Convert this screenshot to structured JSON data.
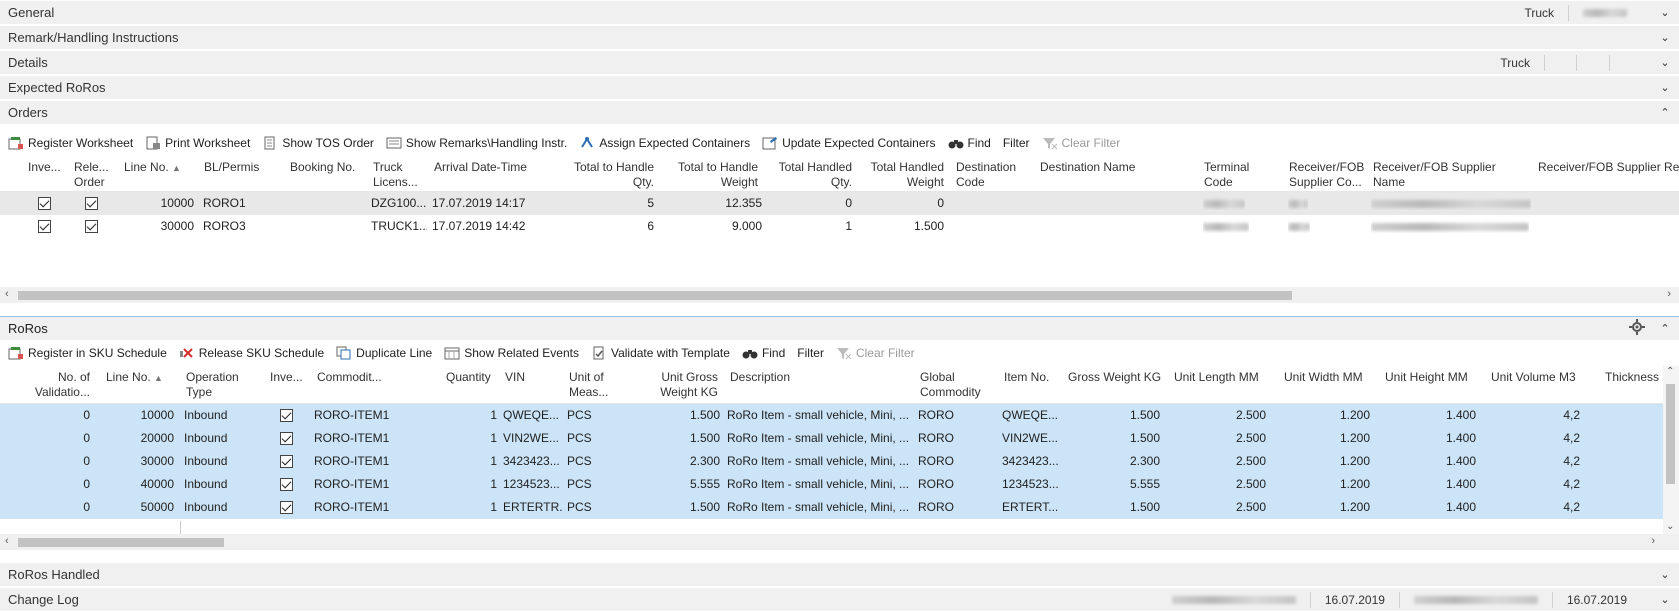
{
  "fasttabs": {
    "general": {
      "title": "General",
      "summary": "Truck"
    },
    "remark": {
      "title": "Remark/Handling Instructions"
    },
    "details": {
      "title": "Details",
      "summary": "Truck"
    },
    "expected": {
      "title": "Expected RoRos"
    },
    "orders": {
      "title": "Orders"
    },
    "roros_handled": {
      "title": "RoRos Handled"
    },
    "change_log": {
      "title": "Change Log",
      "date1": "16.07.2019",
      "date2": "16.07.2019"
    }
  },
  "orders_toolbar": {
    "register_worksheet": "Register Worksheet",
    "print_worksheet": "Print Worksheet",
    "show_tos_order": "Show TOS Order",
    "show_remarks": "Show Remarks\\Handling Instr.",
    "assign_expected": "Assign Expected Containers",
    "update_expected": "Update Expected Containers",
    "find": "Find",
    "filter": "Filter",
    "clear_filter": "Clear Filter"
  },
  "orders_grid": {
    "headers": {
      "inve": "Inve...",
      "rele1": "Rele...",
      "rele2": "Order",
      "line_no": "Line No.",
      "bl": "BL/Permis",
      "booking": "Booking No.",
      "truck1": "Truck",
      "truck2": "Licens...",
      "arrival": "Arrival Date-Time",
      "tth_qty1": "Total to Handle",
      "tth_qty2": "Qty.",
      "tth_w1": "Total to Handle",
      "tth_w2": "Weight",
      "th_qty1": "Total Handled",
      "th_qty2": "Qty.",
      "th_w1": "Total Handled",
      "th_w2": "Weight",
      "dest1": "Destination",
      "dest2": "Code",
      "dest_name": "Destination Name",
      "term1": "Terminal",
      "term2": "Code",
      "recv1": "Receiver/FOB",
      "recv2": "Supplier Co...",
      "recvn1": "Receiver/FOB Supplier",
      "recvn2": "Name",
      "recvref": "Receiver/FOB Supplier Refe"
    },
    "rows": [
      {
        "line_no": "10000",
        "bl": "RORO1",
        "truck": "DZG100...",
        "arrival": "17.07.2019 14:17",
        "tth_qty": "5",
        "tth_w": "12.355",
        "th_qty": "0",
        "th_w": "0"
      },
      {
        "line_no": "30000",
        "bl": "RORO3",
        "truck": "TRUCK1...",
        "arrival": "17.07.2019 14:42",
        "tth_qty": "6",
        "tth_w": "9.000",
        "th_qty": "1",
        "th_w": "1.500"
      }
    ]
  },
  "roros": {
    "title": "RoRos",
    "toolbar": {
      "register_sku": "Register in SKU Schedule",
      "release_sku": "Release SKU Schedule",
      "duplicate": "Duplicate Line",
      "related_events": "Show Related Events",
      "validate": "Validate with Template",
      "find": "Find",
      "filter": "Filter",
      "clear_filter": "Clear Filter"
    },
    "headers": {
      "noval1": "No. of",
      "noval2": "Validatio...",
      "line_no": "Line No.",
      "optype1": "Operation",
      "optype2": "Type",
      "inve": "Inve...",
      "commodity": "Commodit...",
      "quantity": "Quantity",
      "vin": "VIN",
      "uom1": "Unit of",
      "uom2": "Meas...",
      "ugw1": "Unit Gross",
      "ugw2": "Weight KG",
      "description": "Description",
      "global1": "Global",
      "global2": "Commodity",
      "item_no": "Item No.",
      "gross": "Gross Weight KG",
      "ulen": "Unit Length MM",
      "uwid": "Unit Width MM",
      "uhei": "Unit Height MM",
      "uvol": "Unit Volume M3",
      "thick": "Thickness"
    },
    "rows": [
      {
        "noval": "0",
        "line_no": "10000",
        "optype": "Inbound",
        "commodity": "RORO-ITEM1",
        "quantity": "1",
        "vin": "QWEQE...",
        "uom": "PCS",
        "ugw": "1.500",
        "description": "RoRo Item - small vehicle, Mini, ...",
        "global": "RORO",
        "item_no": "QWEQE...",
        "gross": "1.500",
        "ulen": "2.500",
        "uwid": "1.200",
        "uhei": "1.400",
        "uvol": "4,2"
      },
      {
        "noval": "0",
        "line_no": "20000",
        "optype": "Inbound",
        "commodity": "RORO-ITEM1",
        "quantity": "1",
        "vin": "VIN2WE...",
        "uom": "PCS",
        "ugw": "1.500",
        "description": "RoRo Item - small vehicle, Mini, ...",
        "global": "RORO",
        "item_no": "VIN2WE...",
        "gross": "1.500",
        "ulen": "2.500",
        "uwid": "1.200",
        "uhei": "1.400",
        "uvol": "4,2"
      },
      {
        "noval": "0",
        "line_no": "30000",
        "optype": "Inbound",
        "commodity": "RORO-ITEM1",
        "quantity": "1",
        "vin": "3423423...",
        "uom": "PCS",
        "ugw": "2.300",
        "description": "RoRo Item - small vehicle, Mini, ...",
        "global": "RORO",
        "item_no": "3423423...",
        "gross": "2.300",
        "ulen": "2.500",
        "uwid": "1.200",
        "uhei": "1.400",
        "uvol": "4,2"
      },
      {
        "noval": "0",
        "line_no": "40000",
        "optype": "Inbound",
        "commodity": "RORO-ITEM1",
        "quantity": "1",
        "vin": "1234523...",
        "uom": "PCS",
        "ugw": "5.555",
        "description": "RoRo Item - small vehicle, Mini, ...",
        "global": "RORO",
        "item_no": "1234523...",
        "gross": "5.555",
        "ulen": "2.500",
        "uwid": "1.200",
        "uhei": "1.400",
        "uvol": "4,2"
      },
      {
        "noval": "0",
        "line_no": "50000",
        "optype": "Inbound",
        "commodity": "RORO-ITEM1",
        "quantity": "1",
        "vin": "ERTERTR...",
        "uom": "PCS",
        "ugw": "1.500",
        "description": "RoRo Item - small vehicle, Mini, ...",
        "global": "RORO",
        "item_no": "ERTERT...",
        "gross": "1.500",
        "ulen": "2.500",
        "uwid": "1.200",
        "uhei": "1.400",
        "uvol": "4,2"
      }
    ]
  },
  "colors": {
    "selected_row": "#cfe3f3",
    "roros_row": "#cce4f7",
    "header_bg": "#f0f0f0",
    "accent": "#2a6fb5"
  },
  "icons": {
    "expand": "chevron-down-icon",
    "collapse": "chevron-up-icon"
  }
}
